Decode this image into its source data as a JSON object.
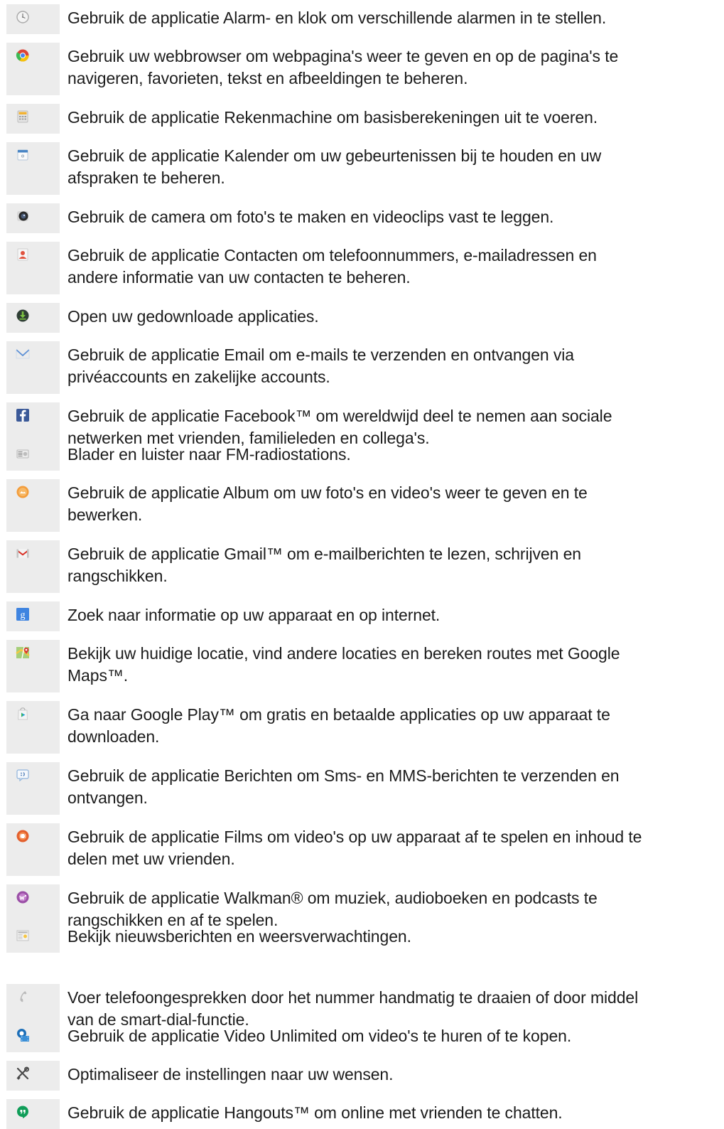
{
  "apps": [
    {
      "icon": "alarm-clock-icon",
      "lines": [
        "Gebruik de applicatie Alarm- en klok om verschillende alarmen in te stellen."
      ]
    },
    {
      "icon": "browser-icon",
      "lines": [
        "Gebruik uw webbrowser om webpagina's weer te geven en op de pagina's te",
        "navigeren, favorieten, tekst en afbeeldingen te beheren."
      ]
    },
    {
      "icon": "calculator-icon",
      "lines": [
        "Gebruik de applicatie Rekenmachine om basisberekeningen uit te voeren."
      ]
    },
    {
      "icon": "calendar-icon",
      "lines": [
        "Gebruik de applicatie Kalender om uw gebeurtenissen bij te houden en uw",
        "afspraken te beheren."
      ]
    },
    {
      "icon": "camera-icon",
      "lines": [
        "Gebruik de camera om foto's te maken en videoclips vast te leggen."
      ]
    },
    {
      "icon": "contacts-icon",
      "lines": [
        "Gebruik de applicatie Contacten om telefoonnummers, e-mailadressen en",
        "andere informatie van uw contacten te beheren."
      ]
    },
    {
      "icon": "download-icon",
      "lines": [
        "Open uw gedownloade applicaties."
      ]
    },
    {
      "icon": "email-icon",
      "lines": [
        "Gebruik de applicatie Email om e-mails te verzenden en ontvangen via",
        "privéaccounts en zakelijke accounts."
      ]
    },
    {
      "icon": "facebook-icon",
      "lines": [
        "Gebruik de applicatie Facebook™ om wereldwijd deel te nemen aan sociale",
        "netwerken met vrienden, familieleden en collega's."
      ]
    },
    {
      "icon": "fm-radio-icon",
      "lines": [
        "Blader en luister naar FM-radiostations."
      ]
    },
    {
      "icon": "album-icon",
      "lines": [
        "Gebruik de applicatie Album om uw foto's en video's weer te geven en te",
        "bewerken."
      ]
    },
    {
      "icon": "gmail-icon",
      "lines": [
        "Gebruik de applicatie Gmail™ om e-mailberichten te lezen, schrijven en",
        "rangschikken."
      ]
    },
    {
      "icon": "google-search-icon",
      "lines": [
        "Zoek naar informatie op uw apparaat en op internet."
      ]
    },
    {
      "icon": "maps-icon",
      "lines": [
        "Bekijk uw huidige locatie, vind andere locaties en bereken routes met Google",
        "Maps™."
      ]
    },
    {
      "icon": "play-store-icon",
      "lines": [
        "Ga naar Google Play™ om gratis en betaalde applicaties op uw apparaat te",
        "downloaden."
      ]
    },
    {
      "icon": "messaging-icon",
      "lines": [
        "Gebruik de applicatie Berichten om Sms- en MMS-berichten te verzenden en",
        "ontvangen."
      ]
    },
    {
      "icon": "movies-icon",
      "lines": [
        "Gebruik de applicatie Films om video's op uw apparaat af te spelen en inhoud te",
        "delen met uw vrienden."
      ]
    },
    {
      "icon": "walkman-icon",
      "lines": [
        "Gebruik de applicatie Walkman® om muziek, audioboeken en podcasts te",
        "rangschikken en af te spelen."
      ]
    },
    {
      "icon": "news-weather-icon",
      "lines": [
        "Bekijk nieuwsberichten en weersverwachtingen."
      ]
    },
    {
      "icon": "phone-icon",
      "lines": [
        "Voer telefoongesprekken door het nummer handmatig te draaien of door middel",
        "van de smart-dial-functie."
      ]
    },
    {
      "icon": "video-unlimited-icon",
      "lines": [
        "Gebruik de applicatie Video Unlimited om video's te huren of te kopen."
      ]
    },
    {
      "icon": "settings-tools-icon",
      "lines": [
        "Optimaliseer de instellingen naar uw wensen."
      ]
    },
    {
      "icon": "hangouts-icon",
      "lines": [
        "Gebruik de applicatie Hangouts™ om online met vrienden te chatten."
      ]
    }
  ]
}
